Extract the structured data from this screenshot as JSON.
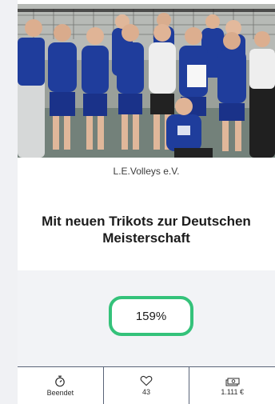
{
  "project": {
    "image_alt": "Volleyball team celebrating with medals and trophy",
    "organization": "L.E.Volleys e.V.",
    "title": "Mit neuen Trikots zur Deutschen Meisterschaft",
    "funding_percent": "159%"
  },
  "stats": [
    {
      "icon": "stopwatch-icon",
      "label": "Beendet"
    },
    {
      "icon": "heart-icon",
      "label": "43"
    },
    {
      "icon": "money-icon",
      "label": "1.111 €"
    }
  ],
  "colors": {
    "accent": "#34c27a",
    "jersey": "#1f3d9c",
    "footer_border": "#5a6478"
  }
}
